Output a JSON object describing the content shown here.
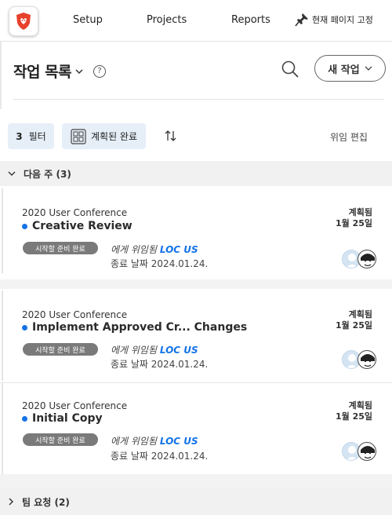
{
  "topnav": {
    "items": [
      {
        "label": "Setup"
      },
      {
        "label": "Projects"
      },
      {
        "label": "Reports"
      }
    ],
    "pin_label": "현재 페이지 고정"
  },
  "header": {
    "title": "작업 목록",
    "help": "?",
    "new_task": "새 작업"
  },
  "toolbar": {
    "filter_count": "3",
    "filter_label": "필터",
    "planned_label": "계획된 완료",
    "delegate_edit": "위임 편집"
  },
  "groups": [
    {
      "label": "다음 주",
      "count": "(3)",
      "expanded": true
    },
    {
      "label": "팀 요청",
      "count": "(2)",
      "expanded": false
    }
  ],
  "tasks": [
    {
      "project": "2020 User Conference",
      "name": "Creative Review",
      "status": "시작할 준비 완료",
      "delegated_prefix": "에게 위임됨",
      "delegated_to": "LOC US",
      "due": "종료 날짜 2024.01.24.",
      "planned_label": "계획됨",
      "planned_date": "1월 25일"
    },
    {
      "project": "2020 User Conference",
      "name": "Implement Approved Cr... Changes",
      "status": "시작할 준비 완료",
      "delegated_prefix": "에게 위임됨",
      "delegated_to": "LOC US",
      "due": "종료 날짜 2024.01.24.",
      "planned_label": "계획됨",
      "planned_date": "1월 25일"
    },
    {
      "project": "2020 User Conference",
      "name": "Initial Copy",
      "status": "시작할 준비 완료",
      "delegated_prefix": "에게 위임됨",
      "delegated_to": "LOC US",
      "due": "종료 날짜 2024.01.24.",
      "planned_label": "계획됨",
      "planned_date": "1월 25일"
    }
  ],
  "colors": {
    "accent": "#1473e6",
    "pill": "#7a7a7a",
    "toolbar_button_bg": "#e6eef8",
    "group_bg": "#f1f1f1",
    "logo": "#e8412c"
  }
}
